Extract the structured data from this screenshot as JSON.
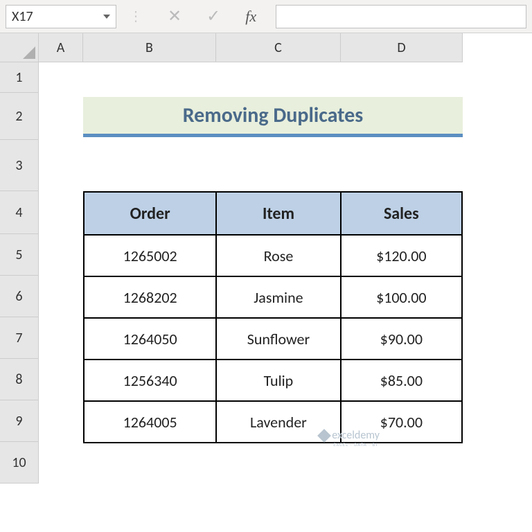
{
  "formula_bar": {
    "name_box": "X17",
    "fx_label": "fx",
    "formula_value": ""
  },
  "columns": [
    "A",
    "B",
    "C",
    "D"
  ],
  "rows": [
    "1",
    "2",
    "3",
    "4",
    "5",
    "6",
    "7",
    "8",
    "9",
    "10"
  ],
  "col_widths": {
    "A": 64,
    "B": 192,
    "C": 180,
    "D": 176
  },
  "row_heights": {
    "1": 44,
    "2": 68,
    "3": 74,
    "4": 62,
    "5": 60,
    "6": 60,
    "7": 60,
    "8": 60,
    "9": 60,
    "10": 60
  },
  "title": "Removing Duplicates",
  "table": {
    "headers": [
      "Order",
      "Item",
      "Sales"
    ],
    "rows": [
      {
        "order": "1265002",
        "item": "Rose",
        "sales": "$120.00"
      },
      {
        "order": "1268202",
        "item": "Jasmine",
        "sales": "$100.00"
      },
      {
        "order": "1264050",
        "item": "Sunflower",
        "sales": "$90.00"
      },
      {
        "order": "1256340",
        "item": "Tulip",
        "sales": "$85.00"
      },
      {
        "order": "1264005",
        "item": "Lavender",
        "sales": "$70.00"
      }
    ]
  },
  "watermark": {
    "text": "exceldemy",
    "sub": "EXCEL · DATA · BI"
  }
}
